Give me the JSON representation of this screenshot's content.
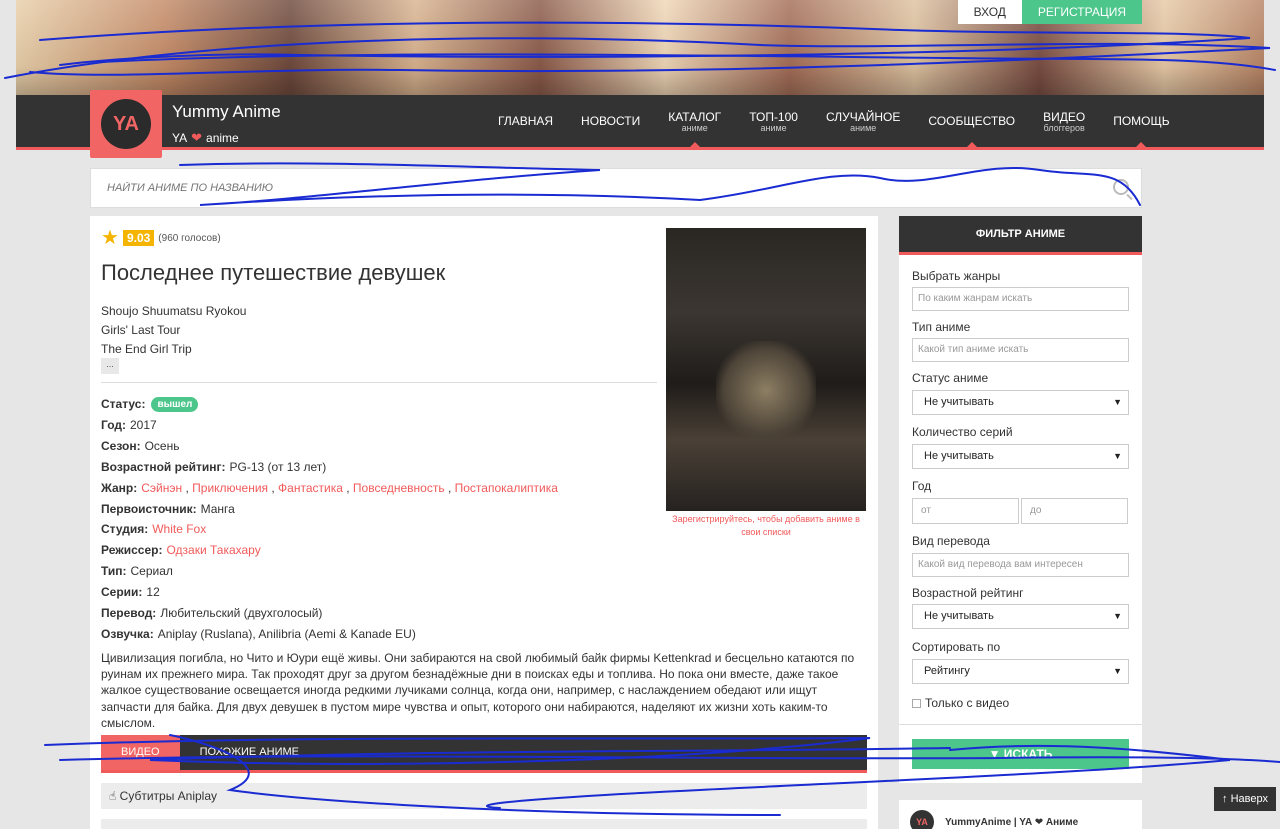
{
  "auth": {
    "login": "ВХОД",
    "register": "РЕГИСТРАЦИЯ"
  },
  "site": {
    "name": "Yummy Anime",
    "tag_prefix": "YA",
    "tag_suffix": "anime",
    "logo_text": "YA"
  },
  "nav": [
    {
      "label": "ГЛАВНАЯ",
      "sub": ""
    },
    {
      "label": "НОВОСТИ",
      "sub": ""
    },
    {
      "label": "КАТАЛОГ",
      "sub": "аниме"
    },
    {
      "label": "ТОП-100",
      "sub": "аниме"
    },
    {
      "label": "СЛУЧАЙНОЕ",
      "sub": "аниме"
    },
    {
      "label": "СООБЩЕСТВО",
      "sub": ""
    },
    {
      "label": "ВИДЕО",
      "sub": "блоггеров"
    },
    {
      "label": "ПОМОЩЬ",
      "sub": ""
    }
  ],
  "search": {
    "placeholder": "НАЙТИ АНИМЕ ПО НАЗВАНИЮ"
  },
  "anime": {
    "rating": "9.03",
    "votes": "(960 голосов)",
    "title": "Последнее путешествие девушек",
    "alt_names": [
      "Shoujo Shuumatsu Ryokou",
      "Girls' Last Tour",
      "The End Girl Trip"
    ],
    "more": "...",
    "status_label": "Статус:",
    "status": "вышел",
    "year_label": "Год:",
    "year": "2017",
    "season_label": "Сезон:",
    "season": "Осень",
    "age_label": "Возрастной рейтинг:",
    "age": "PG-13 (от 13 лет)",
    "genre_label": "Жанр:",
    "genres": [
      "Сэйнэн",
      "Приключения",
      "Фантастика",
      "Повседневность",
      "Постапокалиптика"
    ],
    "source_label": "Первоисточник:",
    "source": "Манга",
    "studio_label": "Студия:",
    "studio": "White Fox",
    "director_label": "Режиссер:",
    "director": "Одзаки Такахару",
    "type_label": "Тип:",
    "type": "Сериал",
    "episodes_label": "Серии:",
    "episodes": "12",
    "translation_label": "Перевод:",
    "translation": "Любительский (двухголосый)",
    "voice_label": "Озвучка:",
    "voice": "Aniplay (Ruslana), Anilibria (Aemi & Kanade EU)",
    "poster_note": "Зарегистрируйтесь, чтобы добавить аниме в свои списки",
    "description": "Цивилизация погибла, но Чито и Юури ещё живы. Они забираются на свой любимый байк фирмы Kettenkrad и бесцельно катаются по руинам их прежнего мира. Так проходят друг за другом безнадёжные дни в поисках еды и топлива. Но пока они вместе, даже такое жалкое существование освещается иногда редкими лучиками солнца, когда они, например, с наслаждением обедают или ищут запчасти для байка. Для двух девушек в пустом мире чувства и опыт, которого они набираются, наделяют их жизни хоть каким-то смыслом."
  },
  "tabs": {
    "video": "ВИДЕО",
    "similar": "ПОХОЖИЕ АНИМЕ"
  },
  "subtitles": "Субтитры Aniplay",
  "filter": {
    "header": "ФИЛЬТР АНИМЕ",
    "genres_label": "Выбрать жанры",
    "genres_placeholder": "По каким жанрам искать",
    "type_label": "Тип аниме",
    "type_placeholder": "Какой тип аниме искать",
    "status_label": "Статус аниме",
    "status_value": "Не учитывать",
    "episodes_label": "Количество серий",
    "episodes_value": "Не учитывать",
    "year_label": "Год",
    "year_from": "от",
    "year_to": "до",
    "translation_label": "Вид перевода",
    "translation_placeholder": "Какой вид перевода вам интересен",
    "age_label": "Возрастной рейтинг",
    "age_value": "Не учитывать",
    "sort_label": "Сортировать по",
    "sort_value": "Рейтингу",
    "video_only": "Только с видео",
    "search_button": "ИСКАТЬ"
  },
  "widget": {
    "text": "YummyAnime | YA ❤ Аниме"
  },
  "to_top": "Наверх",
  "colors": {
    "accent": "#f15a5a",
    "green": "#4cc68b",
    "dark": "#333333",
    "star": "#f5b400",
    "scribble": "#1a2bd1"
  }
}
